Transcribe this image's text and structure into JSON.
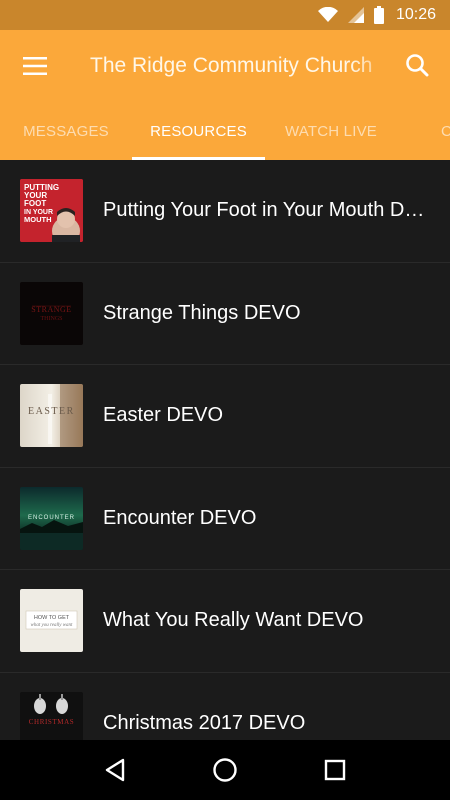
{
  "status_bar": {
    "time": "10:26",
    "icons": [
      "wifi-icon",
      "signal-icon",
      "battery-icon"
    ]
  },
  "app_bar": {
    "title": "The Ridge Community Church",
    "menu_icon": "menu-icon",
    "search_icon": "search-icon",
    "background": "#fba83a"
  },
  "tabs": [
    {
      "label": "MESSAGES",
      "active": false
    },
    {
      "label": "RESOURCES",
      "active": true
    },
    {
      "label": "WATCH LIVE",
      "active": false
    },
    {
      "label": "C",
      "active": false
    }
  ],
  "resources": [
    {
      "title": "Putting Your Foot in Your Mouth DEVO",
      "thumb_text": "PUTTING YOUR FOOT IN YOUR MOUTH"
    },
    {
      "title": "Strange Things DEVO",
      "thumb_text": "STRANGE THINGS"
    },
    {
      "title": "Easter DEVO",
      "thumb_text": "EASTER"
    },
    {
      "title": "Encounter DEVO",
      "thumb_text": "ENCOUNTER"
    },
    {
      "title": "What You Really Want DEVO",
      "thumb_text": "HOW TO GET what you really want"
    },
    {
      "title": "Christmas 2017 DEVO",
      "thumb_text": "CHRISTMAS"
    }
  ],
  "nav_bar": {
    "buttons": [
      "back-icon",
      "home-icon",
      "recents-icon"
    ]
  }
}
